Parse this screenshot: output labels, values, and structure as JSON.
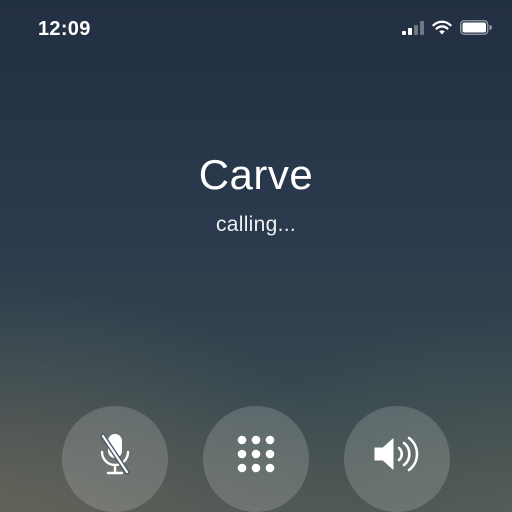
{
  "status_bar": {
    "time": "12:09",
    "signal_icon": "cellular-signal-icon",
    "wifi_icon": "wifi-icon",
    "battery_icon": "battery-icon"
  },
  "call": {
    "caller_name": "Carve",
    "status": "calling..."
  },
  "controls": [
    {
      "name": "mute",
      "icon": "microphone-slash-icon"
    },
    {
      "name": "keypad",
      "icon": "keypad-icon"
    },
    {
      "name": "speaker",
      "icon": "speaker-icon"
    }
  ],
  "colors": {
    "text": "#ffffff",
    "background_top": "#232f42",
    "background_bottom": "#4a5553",
    "button_fill": "rgba(255,255,255,0.16)"
  }
}
